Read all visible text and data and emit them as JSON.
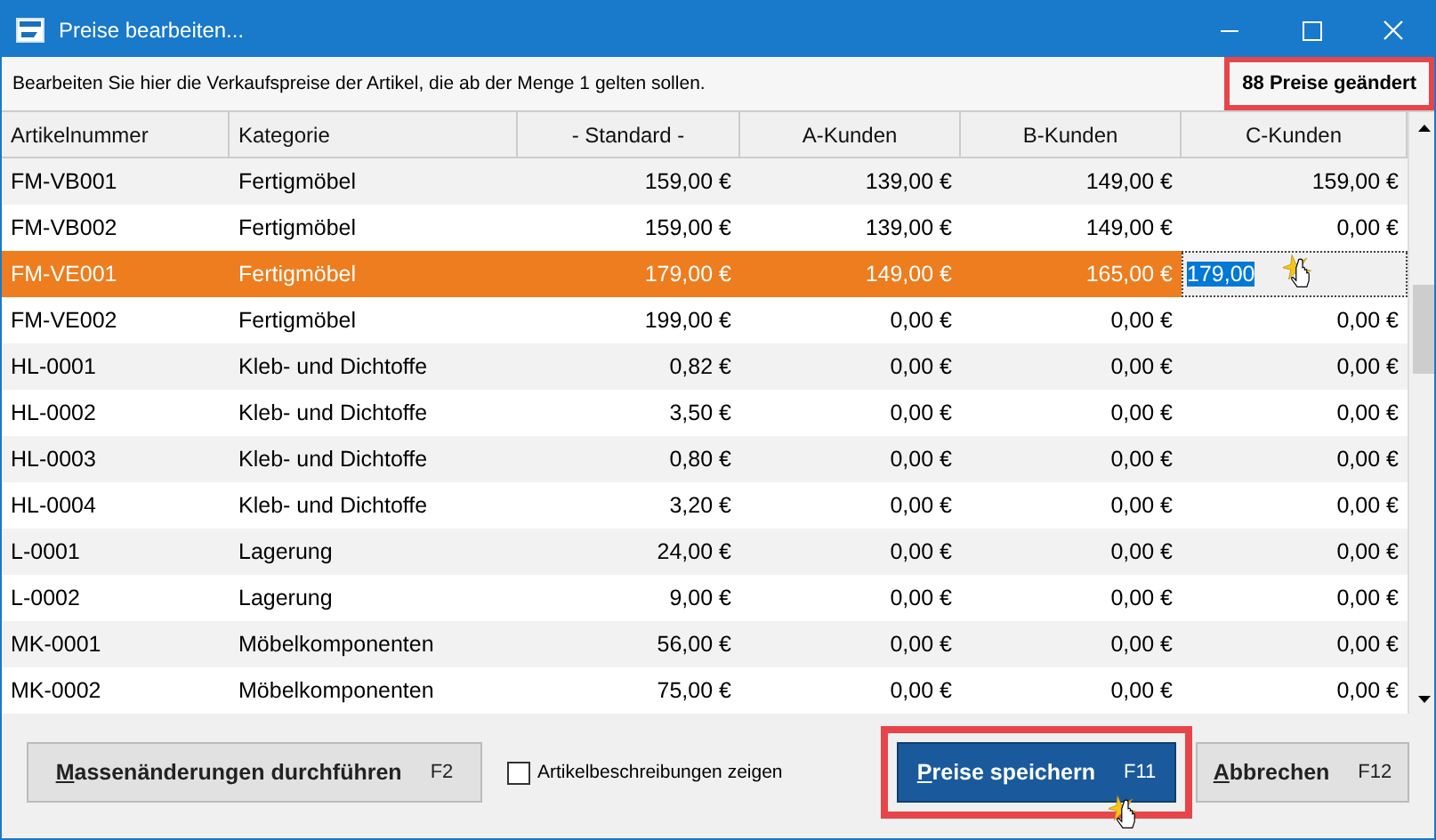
{
  "window": {
    "title": "Preise bearbeiten..."
  },
  "info": {
    "text": "Bearbeiten Sie hier die Verkaufspreise der Artikel, die ab der Menge 1 gelten sollen.",
    "badge": "88 Preise geändert",
    "badge_highlighted": true
  },
  "table": {
    "columns": [
      "Artikelnummer",
      "Kategorie",
      "- Standard -",
      "A-Kunden",
      "B-Kunden",
      "C-Kunden"
    ],
    "rows": [
      {
        "cells": [
          "FM-VB001",
          "Fertigmöbel",
          "159,00 €",
          "139,00 €",
          "149,00 €",
          "159,00 €"
        ],
        "selected": false,
        "editing": false
      },
      {
        "cells": [
          "FM-VB002",
          "Fertigmöbel",
          "159,00 €",
          "139,00 €",
          "149,00 €",
          "0,00 €"
        ],
        "selected": false,
        "editing": false
      },
      {
        "cells": [
          "FM-VE001",
          "Fertigmöbel",
          "179,00 €",
          "149,00 €",
          "165,00 €",
          "179,00"
        ],
        "selected": true,
        "editing": true
      },
      {
        "cells": [
          "FM-VE002",
          "Fertigmöbel",
          "199,00 €",
          "0,00 €",
          "0,00 €",
          "0,00 €"
        ],
        "selected": false,
        "editing": false
      },
      {
        "cells": [
          "HL-0001",
          "Kleb- und Dichtoffe",
          "0,82 €",
          "0,00 €",
          "0,00 €",
          "0,00 €"
        ],
        "selected": false,
        "editing": false
      },
      {
        "cells": [
          "HL-0002",
          "Kleb- und Dichtoffe",
          "3,50 €",
          "0,00 €",
          "0,00 €",
          "0,00 €"
        ],
        "selected": false,
        "editing": false
      },
      {
        "cells": [
          "HL-0003",
          "Kleb- und Dichtoffe",
          "0,80 €",
          "0,00 €",
          "0,00 €",
          "0,00 €"
        ],
        "selected": false,
        "editing": false
      },
      {
        "cells": [
          "HL-0004",
          "Kleb- und Dichtoffe",
          "3,20 €",
          "0,00 €",
          "0,00 €",
          "0,00 €"
        ],
        "selected": false,
        "editing": false
      },
      {
        "cells": [
          "L-0001",
          "Lagerung",
          "24,00 €",
          "0,00 €",
          "0,00 €",
          "0,00 €"
        ],
        "selected": false,
        "editing": false
      },
      {
        "cells": [
          "L-0002",
          "Lagerung",
          "9,00 €",
          "0,00 €",
          "0,00 €",
          "0,00 €"
        ],
        "selected": false,
        "editing": false
      },
      {
        "cells": [
          "MK-0001",
          "Möbelkomponenten",
          "56,00 €",
          "0,00 €",
          "0,00 €",
          "0,00 €"
        ],
        "selected": false,
        "editing": false
      },
      {
        "cells": [
          "MK-0002",
          "Möbelkomponenten",
          "75,00 €",
          "0,00 €",
          "0,00 €",
          "0,00 €"
        ],
        "selected": false,
        "editing": false
      }
    ]
  },
  "footer": {
    "mass_button": {
      "label": "Massenänderungen durchführen",
      "shortcut": "F2"
    },
    "checkbox": {
      "label": "Artikelbeschreibungen zeigen",
      "checked": false
    },
    "save_button": {
      "label": "Preise speichern",
      "shortcut": "F11",
      "highlighted": true
    },
    "cancel_button": {
      "label": "Abbrechen",
      "shortcut": "F12"
    }
  }
}
